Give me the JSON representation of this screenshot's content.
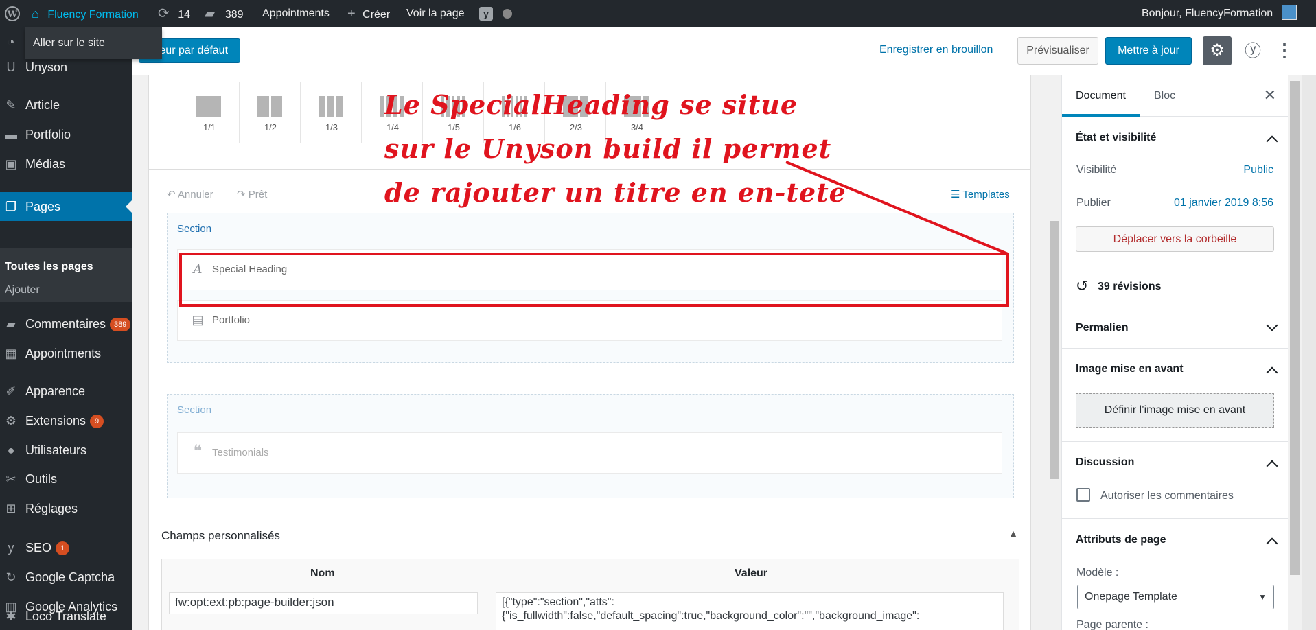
{
  "admin_bar": {
    "site_name": "Fluency Formation",
    "updates_count": "14",
    "comments_count": "389",
    "appointments": "Appointments",
    "new_label": "Créer",
    "view_page": "Voir la page",
    "greeting": "Bonjour, FluencyFormation",
    "dropdown_item": "Aller sur le site"
  },
  "sidebar": {
    "items": [
      {
        "label": "Unyson",
        "icon": "unyson-icon"
      },
      {
        "label": "Article",
        "icon": "pin-icon"
      },
      {
        "label": "Portfolio",
        "icon": "folder-icon"
      },
      {
        "label": "Médias",
        "icon": "media-icon"
      },
      {
        "label": "Pages",
        "icon": "pages-icon"
      },
      {
        "label": "Commentaires",
        "icon": "comment-icon",
        "badge": "389"
      },
      {
        "label": "Appointments",
        "icon": "calendar-icon"
      },
      {
        "label": "Apparence",
        "icon": "brush-icon"
      },
      {
        "label": "Extensions",
        "icon": "plugin-icon",
        "badge": "9"
      },
      {
        "label": "Utilisateurs",
        "icon": "user-icon"
      },
      {
        "label": "Outils",
        "icon": "wrench-icon"
      },
      {
        "label": "Réglages",
        "icon": "settings-icon"
      },
      {
        "label": "SEO",
        "icon": "yoast-icon",
        "badge": "1"
      },
      {
        "label": "Google Captcha",
        "icon": "captcha-icon"
      },
      {
        "label": "Google Analytics",
        "icon": "analytics-icon"
      },
      {
        "label": "Loco Translate",
        "icon": "translate-icon"
      }
    ],
    "submenu": {
      "all_pages": "Toutes les pages",
      "add": "Ajouter"
    }
  },
  "editor_header": {
    "default_editor": "itteur par défaut",
    "save_draft": "Enregistrer en brouillon",
    "preview": "Prévisualiser",
    "update": "Mettre à jour"
  },
  "builder": {
    "layouts": [
      "1/1",
      "1/2",
      "1/3",
      "1/4",
      "1/5",
      "1/6",
      "2/3",
      "3/4"
    ],
    "undo": "Annuler",
    "redo": "Prêt",
    "templates": "Templates",
    "sections": [
      {
        "title": "Section",
        "items": [
          "Special Heading",
          "Portfolio"
        ]
      },
      {
        "title": "Section",
        "items": [
          "Testimonials"
        ]
      }
    ]
  },
  "custom_fields": {
    "title": "Champs personnalisés",
    "col_name": "Nom",
    "col_value": "Valeur",
    "name_value": "fw:opt:ext:pb:page-builder:json",
    "value_line1": "[{\"type\":\"section\",\"atts\":",
    "value_line2": "{\"is_fullwidth\":false,\"default_spacing\":true,\"background_color\":\"\",\"background_image\":"
  },
  "annotation": {
    "line1": "Le SpecialHeading se situe",
    "line2": "sur le Unyson build il permet",
    "line3": "de rajouter un titre en en-tete",
    "color": "#e0141e"
  },
  "settings": {
    "tab_document": "Document",
    "tab_block": "Bloc",
    "status_title": "État et visibilité",
    "visibility_label": "Visibilité",
    "visibility_value": "Public",
    "publish_label": "Publier",
    "publish_value": "01 janvier 2019 8:56",
    "trash_button": "Déplacer vers la corbeille",
    "revisions": "39 révisions",
    "permalink": "Permalien",
    "featured_image": "Image mise en avant",
    "set_featured": "Définir l’image mise en avant",
    "discussion": "Discussion",
    "allow_comments": "Autoriser les commentaires",
    "page_attributes": "Attributs de page",
    "template_label": "Modèle :",
    "template_value": "Onepage Template",
    "parent_label": "Page parente :"
  },
  "colors": {
    "admin_bar": "#23282d",
    "accent": "#0073aa",
    "primary_button": "#0085ba",
    "badge": "#d54e21",
    "annotation": "#e0141e"
  }
}
